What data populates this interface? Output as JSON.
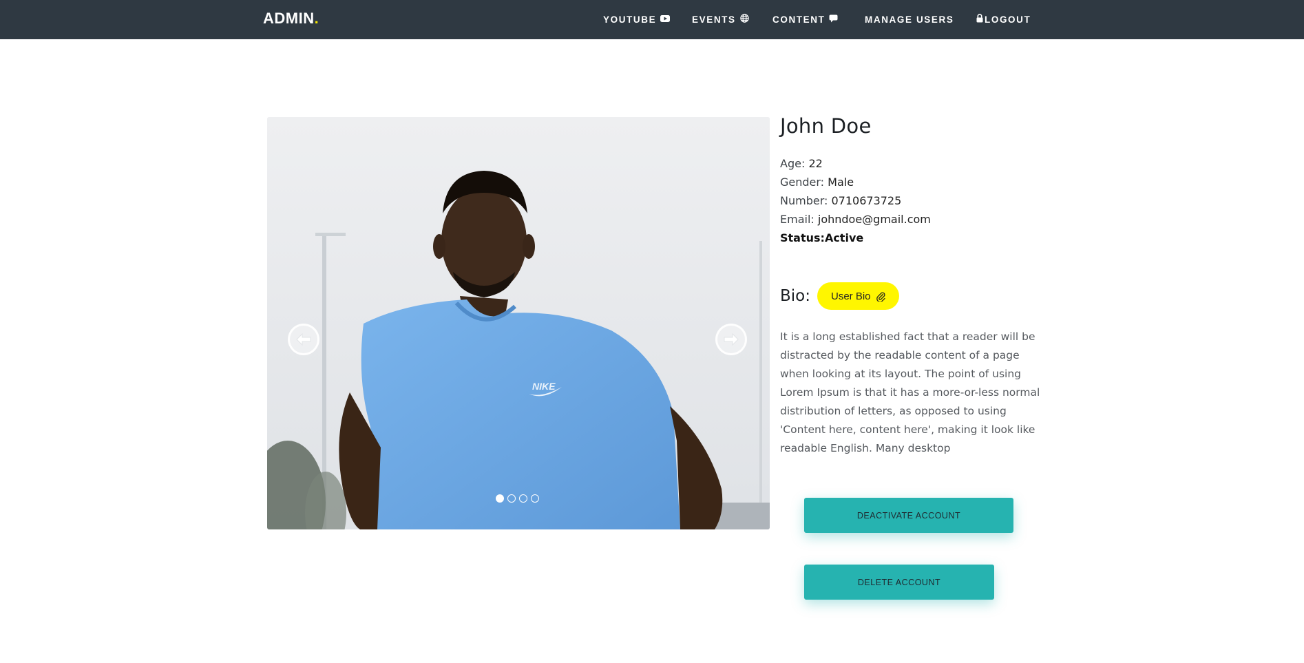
{
  "navbar": {
    "brand": "ADMIN",
    "brand_dot": ".",
    "items": [
      {
        "label": "YOUTUBE",
        "icon": "youtube-icon"
      },
      {
        "label": "EVENTS",
        "icon": "globe-icon"
      },
      {
        "label": "CONTENT",
        "icon": "comment-icon"
      },
      {
        "label": "MANAGE USERS",
        "icon": ""
      },
      {
        "label": "LOGOUT",
        "icon": "lock-icon"
      }
    ]
  },
  "carousel": {
    "slide_count": 4,
    "active_index": 0,
    "shirt_logo": "NIKE"
  },
  "profile": {
    "name": "John Doe",
    "age_label": "Age:",
    "age": "22",
    "gender_label": "Gender:",
    "gender": "Male",
    "number_label": "Number:",
    "number": "0710673725",
    "email_label": "Email:",
    "email": "johndoe@gmail.com",
    "status_label": "Status:",
    "status": "Active"
  },
  "bio": {
    "label": "Bio:",
    "button_label": "User Bio",
    "button_icon": "paperclip-icon",
    "text": "It is a long established fact that a reader will be distracted by the readable content of a page when looking at its layout. The point of using Lorem Ipsum is that it has a more-or-less normal distribution of letters, as opposed to using 'Content here, content here', making it look like readable English. Many desktop"
  },
  "actions": {
    "deactivate": "DEACTIVATE ACCOUNT",
    "delete": "DELETE ACCOUNT"
  },
  "colors": {
    "navbar_bg": "#2f3942",
    "brand_dot": "#f3e500",
    "bio_button": "#fff600",
    "action_button": "#26b3b0"
  }
}
